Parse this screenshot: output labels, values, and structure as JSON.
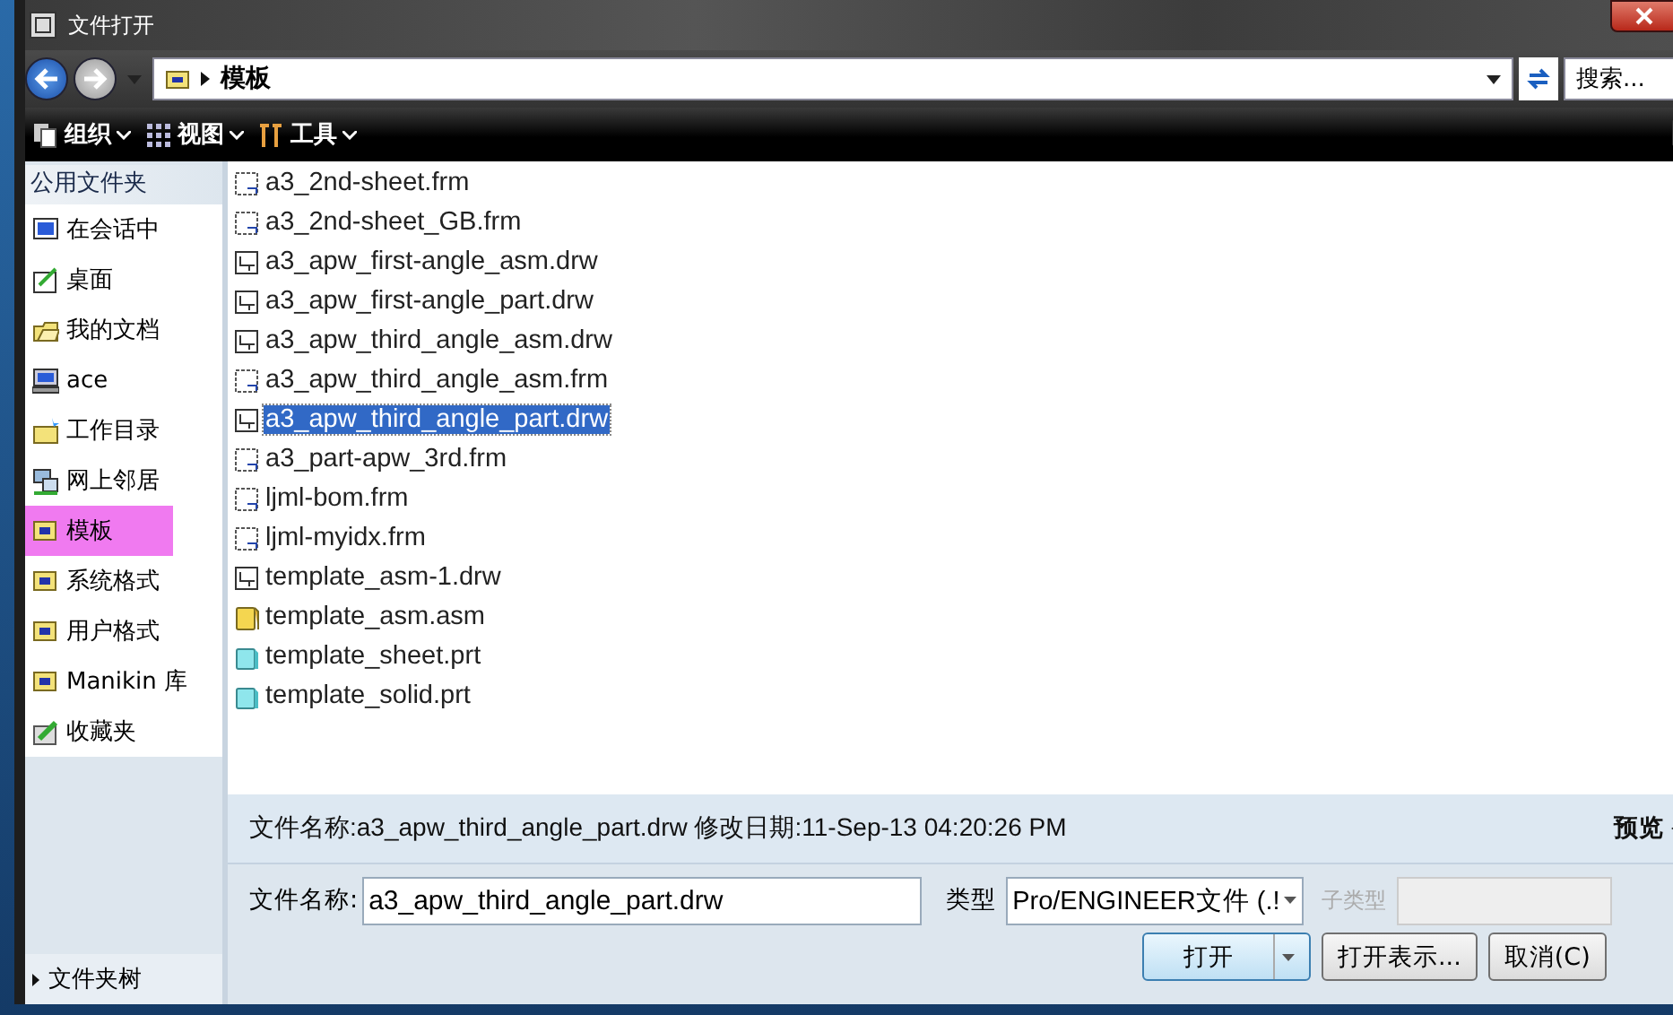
{
  "window": {
    "title": "文件打开"
  },
  "address": {
    "path": "模板",
    "search_placeholder": "搜索..."
  },
  "toolbar": [
    {
      "label": "组织",
      "kind": "organize"
    },
    {
      "label": "视图",
      "kind": "view"
    },
    {
      "label": "工具",
      "kind": "tools"
    }
  ],
  "sidebar": {
    "header": "公用文件夹",
    "items": [
      {
        "label": "在会话中",
        "kind": "session",
        "selected": false
      },
      {
        "label": "桌面",
        "kind": "desktop",
        "selected": false
      },
      {
        "label": "我的文档",
        "kind": "documents",
        "selected": false
      },
      {
        "label": "ace",
        "kind": "computer",
        "selected": false
      },
      {
        "label": "工作目录",
        "kind": "workdir",
        "selected": false
      },
      {
        "label": "网上邻居",
        "kind": "network",
        "selected": false
      },
      {
        "label": "模板",
        "kind": "folder",
        "selected": true
      },
      {
        "label": "系统格式",
        "kind": "folder",
        "selected": false
      },
      {
        "label": "用户格式",
        "kind": "folder",
        "selected": false
      },
      {
        "label": "Manikin 库",
        "kind": "folder",
        "selected": false
      },
      {
        "label": "收藏夹",
        "kind": "favorites",
        "selected": false
      }
    ],
    "tree_label": "文件夹树"
  },
  "files": [
    {
      "name": "a3_2nd-sheet.frm",
      "kind": "frm",
      "selected": false
    },
    {
      "name": "a3_2nd-sheet_GB.frm",
      "kind": "frm",
      "selected": false
    },
    {
      "name": "a3_apw_first-angle_asm.drw",
      "kind": "drw",
      "selected": false
    },
    {
      "name": "a3_apw_first-angle_part.drw",
      "kind": "drw",
      "selected": false
    },
    {
      "name": "a3_apw_third_angle_asm.drw",
      "kind": "drw",
      "selected": false
    },
    {
      "name": "a3_apw_third_angle_asm.frm",
      "kind": "frm",
      "selected": false
    },
    {
      "name": "a3_apw_third_angle_part.drw",
      "kind": "drw",
      "selected": true
    },
    {
      "name": "a3_part-apw_3rd.frm",
      "kind": "frm",
      "selected": false
    },
    {
      "name": "ljml-bom.frm",
      "kind": "frm",
      "selected": false
    },
    {
      "name": "ljml-myidx.frm",
      "kind": "frm",
      "selected": false
    },
    {
      "name": "template_asm-1.drw",
      "kind": "drw",
      "selected": false
    },
    {
      "name": "template_asm.asm",
      "kind": "asm",
      "selected": false
    },
    {
      "name": "template_sheet.prt",
      "kind": "prt",
      "selected": false
    },
    {
      "name": "template_solid.prt",
      "kind": "prt",
      "selected": false
    }
  ],
  "details": {
    "info": "文件名称:a3_apw_third_angle_part.drw 修改日期:11-Sep-13 04:20:26 PM",
    "preview": "预览"
  },
  "form": {
    "name_label": "文件名称:",
    "name_value": "a3_apw_third_angle_part.drw",
    "type_label": "类型",
    "type_value": "Pro/ENGINEER文件 (.!",
    "subtype_label": "子类型",
    "subtype_disabled": true
  },
  "buttons": [
    {
      "label": "打开",
      "kind": "split"
    },
    {
      "label": "打开表示...",
      "kind": "plain"
    },
    {
      "label": "取消(C)",
      "kind": "plain"
    }
  ]
}
